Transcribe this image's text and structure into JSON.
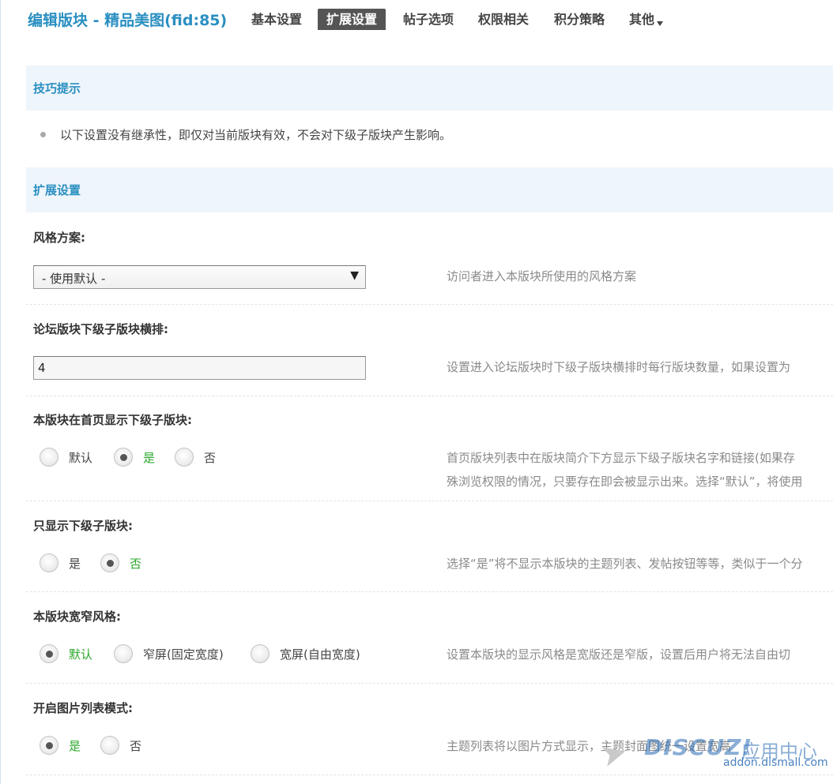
{
  "header": {
    "title": "编辑版块 - 精品美图(fid:85)",
    "tabs": [
      {
        "label": "基本设置",
        "active": false
      },
      {
        "label": "扩展设置",
        "active": true
      },
      {
        "label": "帖子选项",
        "active": false
      },
      {
        "label": "权限相关",
        "active": false
      },
      {
        "label": "积分策略",
        "active": false
      },
      {
        "label": "其他",
        "active": false,
        "has_dropdown": true
      }
    ]
  },
  "tips": {
    "title": "技巧提示",
    "items": [
      "以下设置没有继承性，即仅对当前版块有效，不会对下级子版块产生影响。"
    ]
  },
  "extended": {
    "title": "扩展设置",
    "style_scheme": {
      "label": "风格方案:",
      "selected": "- 使用默认 -",
      "desc": "访问者进入本版块所使用的风格方案"
    },
    "subforum_columns": {
      "label": "论坛版块下级子版块横排:",
      "value": "4",
      "desc": "设置进入论坛版块时下级子版块横排时每行版块数量，如果设置为"
    },
    "show_subforums_home": {
      "label": "本版块在首页显示下级子版块:",
      "options": [
        {
          "label": "默认",
          "checked": true
        },
        {
          "label": "是",
          "checked": false
        },
        {
          "label": "否",
          "checked": false
        }
      ],
      "desc_line1": "首页版块列表中在版块简介下方显示下级子版块名字和链接(如果存",
      "desc_line2": "殊浏览权限的情况，只要存在即会被显示出来。选择“默认”，将使用"
    },
    "only_subforums": {
      "label": "只显示下级子版块:",
      "options": [
        {
          "label": "是",
          "checked": false
        },
        {
          "label": "否",
          "checked": true
        }
      ],
      "desc": "选择“是”将不显示本版块的主题列表、发帖按钮等等，类似于一个分"
    },
    "width_style": {
      "label": "本版块宽窄风格:",
      "options": [
        {
          "label": "默认",
          "checked": true
        },
        {
          "label": "窄屏(固定宽度)",
          "checked": false
        },
        {
          "label": "宽屏(自由宽度)",
          "checked": false
        }
      ],
      "desc": "设置本版块的显示风格是宽版还是窄版，设置后用户将无法自由切"
    },
    "picture_list": {
      "label": "开启图片列表模式:",
      "options": [
        {
          "label": "是",
          "checked": true
        },
        {
          "label": "否",
          "checked": false
        }
      ],
      "desc": "主题列表将以图片方式显示，主题封面图统一设置宽高"
    }
  },
  "watermark": {
    "logo": "DISCUZ!",
    "cn": "应用中心",
    "url": "addon.dismall.com"
  }
}
